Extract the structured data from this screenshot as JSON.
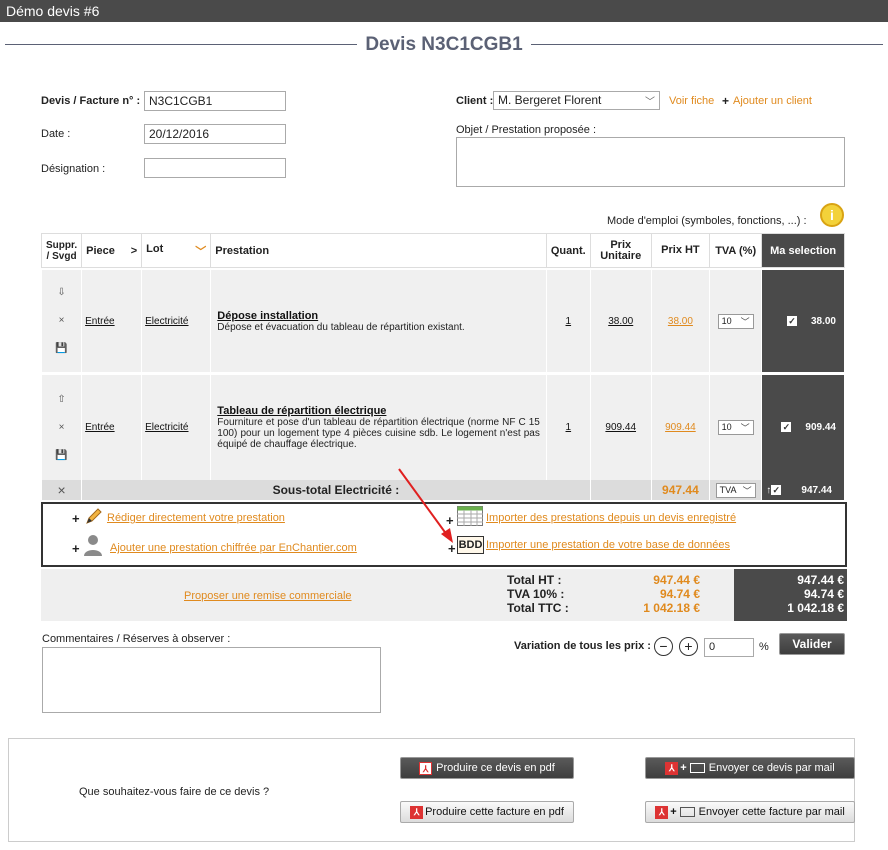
{
  "app_title": "Démo devis #6",
  "page_title": "Devis N3C1CGB1",
  "form": {
    "numero_label": "Devis / Facture n° :",
    "numero_value": "N3C1CGB1",
    "date_label": "Date :",
    "date_value": "20/12/2016",
    "designation_label": "Désignation :",
    "designation_value": "",
    "client_label": "Client :",
    "client_value": "M. Bergeret Florent",
    "voir_fiche": "Voir fiche",
    "ajouter_client": "Ajouter un client",
    "objet_label": "Objet / Prestation proposée :",
    "mode_emploi": "Mode d'emploi (symboles, fonctions, ...) :"
  },
  "table": {
    "headers": {
      "suppr": "Suppr. / Svgd",
      "piece": "Piece",
      "lot": "Lot",
      "prestation": "Prestation",
      "quant": "Quant.",
      "prix_unitaire": "Prix Unitaire",
      "prix_ht": "Prix HT",
      "tva": "TVA (%)",
      "selection": "Ma selection"
    },
    "rows": [
      {
        "piece": "Entrée",
        "lot": "Electricité",
        "title": "Dépose installation",
        "description": "Dépose et évacuation du tableau de répartition existant.",
        "quant": "1",
        "prix_unitaire": "38.00",
        "prix_ht": "38.00",
        "tva": "10",
        "selection": "38.00"
      },
      {
        "piece": "Entrée",
        "lot": "Electricité",
        "title": "Tableau de répartition électrique",
        "description": "Fourniture et pose d'un tableau de répartition électrique (norme NF C 15 100) pour un logement type 4 pièces cuisine sdb. Le logement n'est pas équipé de chauffage électrique.",
        "quant": "1",
        "prix_unitaire": "909.44",
        "prix_ht": "909.44",
        "tva": "10",
        "selection": "909.44"
      }
    ],
    "subtotal": {
      "label": "Sous-total Electricité :",
      "prix_ht": "947.44",
      "tva": "TVA",
      "selection": "947.44"
    }
  },
  "actions": {
    "rediger": "Rédiger directement votre prestation",
    "ajouter_enchantier": "Ajouter une prestation chiffrée par EnChantier.com",
    "importer_devis": "Importer des prestations depuis un devis enregistré",
    "bdd_label": "BDD",
    "importer_bdd": "Importer une prestation de votre base de données"
  },
  "totals": {
    "remise": "Proposer une remise commerciale",
    "ht_label": "Total HT :",
    "ht_value": "947.44 €",
    "tva_label": "TVA 10% :",
    "tva_value": "94.74 €",
    "ttc_label": "Total TTC :",
    "ttc_value": "1 042.18 €",
    "sel_ht": "947.44 €",
    "sel_tva": "94.74 €",
    "sel_ttc": "1 042.18 €"
  },
  "comments_label": "Commentaires / Réserves à observer :",
  "variation": {
    "label": "Variation de tous les prix :",
    "minus": "−",
    "plus": "+",
    "value": "0",
    "unit": "%",
    "valider": "Valider"
  },
  "footer": {
    "question": "Que souhaitez-vous faire de ce devis ?",
    "pdf_devis": "Produire ce devis en pdf",
    "mail_devis": "Envoyer ce devis par mail",
    "pdf_facture": "Produire cette facture en pdf",
    "mail_facture": "Envoyer cette facture par mail"
  },
  "colors": {
    "accent": "#e08a1e",
    "dark": "#4a4a4a",
    "title": "#5b6175",
    "arrow": "#e02020"
  }
}
